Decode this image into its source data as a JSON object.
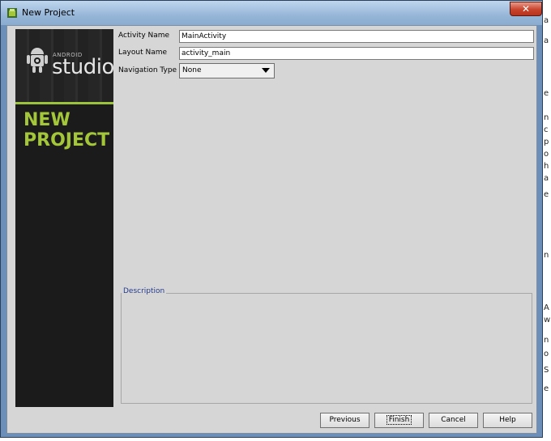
{
  "window": {
    "title": "New Project",
    "close_label": "✕"
  },
  "banner": {
    "logo_small": "ANDROID",
    "logo_large": "studio",
    "heading_line1": "NEW",
    "heading_line2": "PROJECT"
  },
  "form": {
    "activity_name": {
      "label": "Activity Name",
      "value": "MainActivity"
    },
    "layout_name": {
      "label": "Layout Name",
      "value": "activity_main"
    },
    "navigation_type": {
      "label": "Navigation Type",
      "value": "None"
    }
  },
  "description": {
    "legend": "Description"
  },
  "buttons": {
    "previous": "Previous",
    "finish": "Finish",
    "cancel": "Cancel",
    "help": "Help"
  },
  "background_fragments": [
    "a",
    "a",
    "e",
    "n",
    "c",
    "p",
    "o",
    "h",
    "a",
    "e",
    "n",
    "A",
    "w",
    "n",
    "o",
    "S",
    "e"
  ],
  "colors": {
    "accent_green": "#a4c639",
    "banner_bg": "#1b1b1b",
    "dialog_bg": "#d6d6d6",
    "legend_text": "#243b8c",
    "close_button": "#c8442c"
  }
}
